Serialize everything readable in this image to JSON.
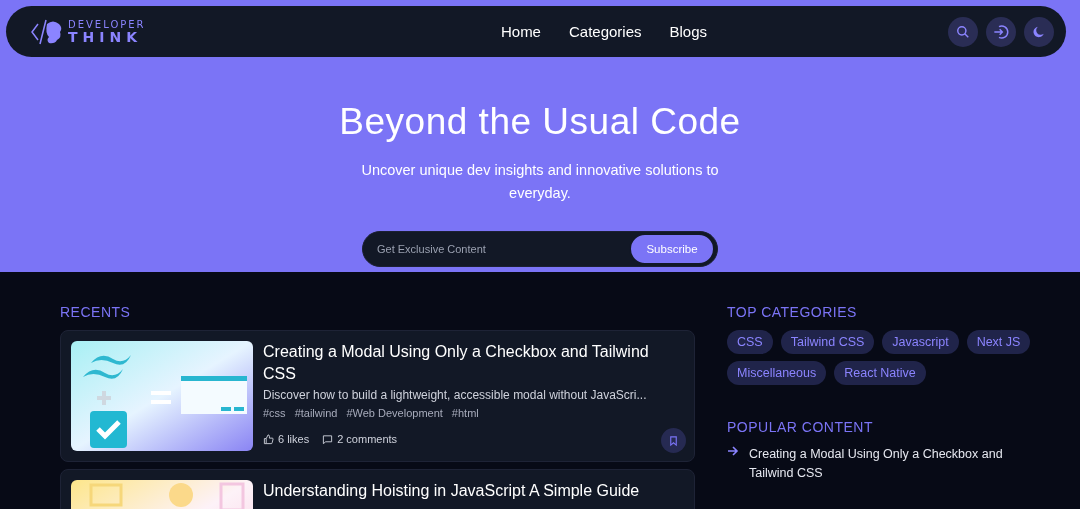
{
  "nav": {
    "logo_top": "DEVELOPER",
    "logo_bottom": "THINK",
    "links": [
      "Home",
      "Categories",
      "Blogs"
    ]
  },
  "hero": {
    "title": "Beyond the Usual Code",
    "subtitle": "Uncover unique dev insights and innovative solutions to everyday.",
    "subscribe": {
      "placeholder": "Get Exclusive Content",
      "button": "Subscribe"
    }
  },
  "recents": {
    "heading": "RECENTS",
    "posts": [
      {
        "title": "Creating a Modal Using Only a Checkbox and Tailwind CSS",
        "excerpt": "Discover how to build a lightweight, accessible modal without JavaScri...",
        "tags": [
          "#css",
          "#tailwind",
          "#Web Development",
          "#html"
        ],
        "likes": "6 likes",
        "comments": "2 comments"
      },
      {
        "title": "Understanding Hoisting in JavaScript A Simple Guide"
      }
    ]
  },
  "top_categories": {
    "heading": "TOP CATEGORIES",
    "items": [
      "CSS",
      "Tailwind CSS",
      "Javascript",
      "Next JS",
      "Miscellaneous",
      "React Native"
    ]
  },
  "popular_content": {
    "heading": "POPULAR CONTENT",
    "items": [
      "Creating a Modal Using Only a Checkbox and Tailwind CSS"
    ]
  }
}
